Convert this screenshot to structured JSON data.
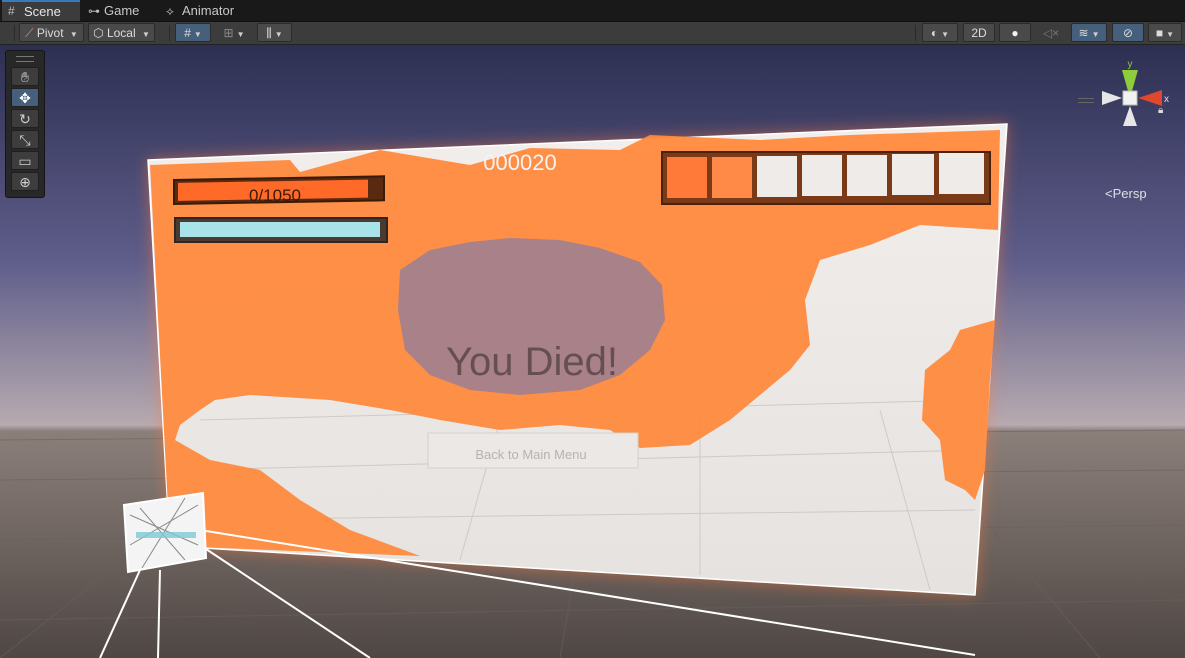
{
  "tabs": [
    {
      "label": "Scene",
      "icon": "grid-icon",
      "active": true
    },
    {
      "label": "Game",
      "icon": "gamepad-icon",
      "active": false
    },
    {
      "label": "Animator",
      "icon": "animator-icon",
      "active": false
    }
  ],
  "toolbar": {
    "pivot_label": "Pivot",
    "local_label": "Local",
    "twod_label": "2D"
  },
  "tools": [
    "hand-tool",
    "move-tool",
    "rotate-tool",
    "scale-tool",
    "rect-tool",
    "transform-tool"
  ],
  "gizmo": {
    "y_label": "y",
    "x_label": "x",
    "persp_label": "Persp"
  },
  "game_ui": {
    "score_text": "000020",
    "health_text": "0/1050",
    "death_text": "You Died!",
    "menu_button_text": "Back to Main Menu",
    "inventory_slots": 7
  },
  "colors": {
    "accent": "#3a79bb",
    "selected_tool": "#46607c",
    "ui_orange": "#ff8a3d",
    "sky_top": "#2d2f52",
    "horizon": "#b7aab0",
    "ground": "#574f4b",
    "gizmo_y": "#8ecc3b",
    "gizmo_x": "#e0472c"
  }
}
